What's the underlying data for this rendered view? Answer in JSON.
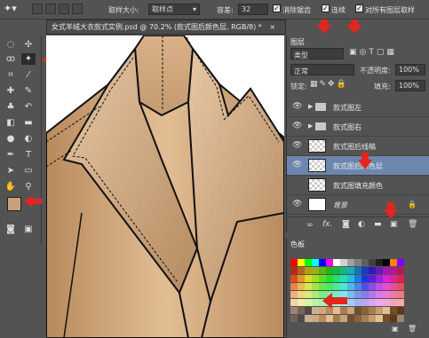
{
  "options_bar": {
    "sample_size_label": "取样大小:",
    "sample_size_value": "取样点",
    "tolerance_label": "容差:",
    "tolerance_value": "32",
    "antialias_label": "消除锯齿",
    "contiguous_label": "连续",
    "sample_all_layers_label": "对所有图层取样"
  },
  "document": {
    "tab_title": "女式羊绒大衣款式实例.psd @ 70.2% (款式图后颜色层, RGB/8) *",
    "close_glyph": "×"
  },
  "layers_panel": {
    "tab_label": "图层",
    "filter_label": "类型",
    "blend_mode": "正常",
    "opacity_label": "不透明度:",
    "opacity_value": "100%",
    "lock_label": "锁定:",
    "fill_label": "填充:",
    "fill_value": "100%",
    "layers": [
      {
        "name": "款式图左",
        "type": "group",
        "visible": true
      },
      {
        "name": "款式图右",
        "type": "group",
        "visible": true
      },
      {
        "name": "款式图后线稿",
        "type": "layer",
        "visible": true
      },
      {
        "name": "款式图后颜色层",
        "type": "layer",
        "visible": true,
        "selected": true
      },
      {
        "name": "款式图填充颜色",
        "type": "layer",
        "visible": false
      },
      {
        "name": "背景",
        "type": "background",
        "visible": true
      }
    ],
    "footer_icons": [
      "link-icon",
      "fx-icon",
      "mask-icon",
      "adjustment-icon",
      "folder-icon",
      "new-layer-icon",
      "trash-icon"
    ]
  },
  "swatches_panel": {
    "tab_label": "色板"
  },
  "colors": {
    "foreground": "#c8a27a",
    "background": "#ffffff",
    "selection": "#6d86ad",
    "annotation_arrow": "#e0261e",
    "coat_base": "#d3a77b",
    "coat_dark": "#a87a50"
  }
}
